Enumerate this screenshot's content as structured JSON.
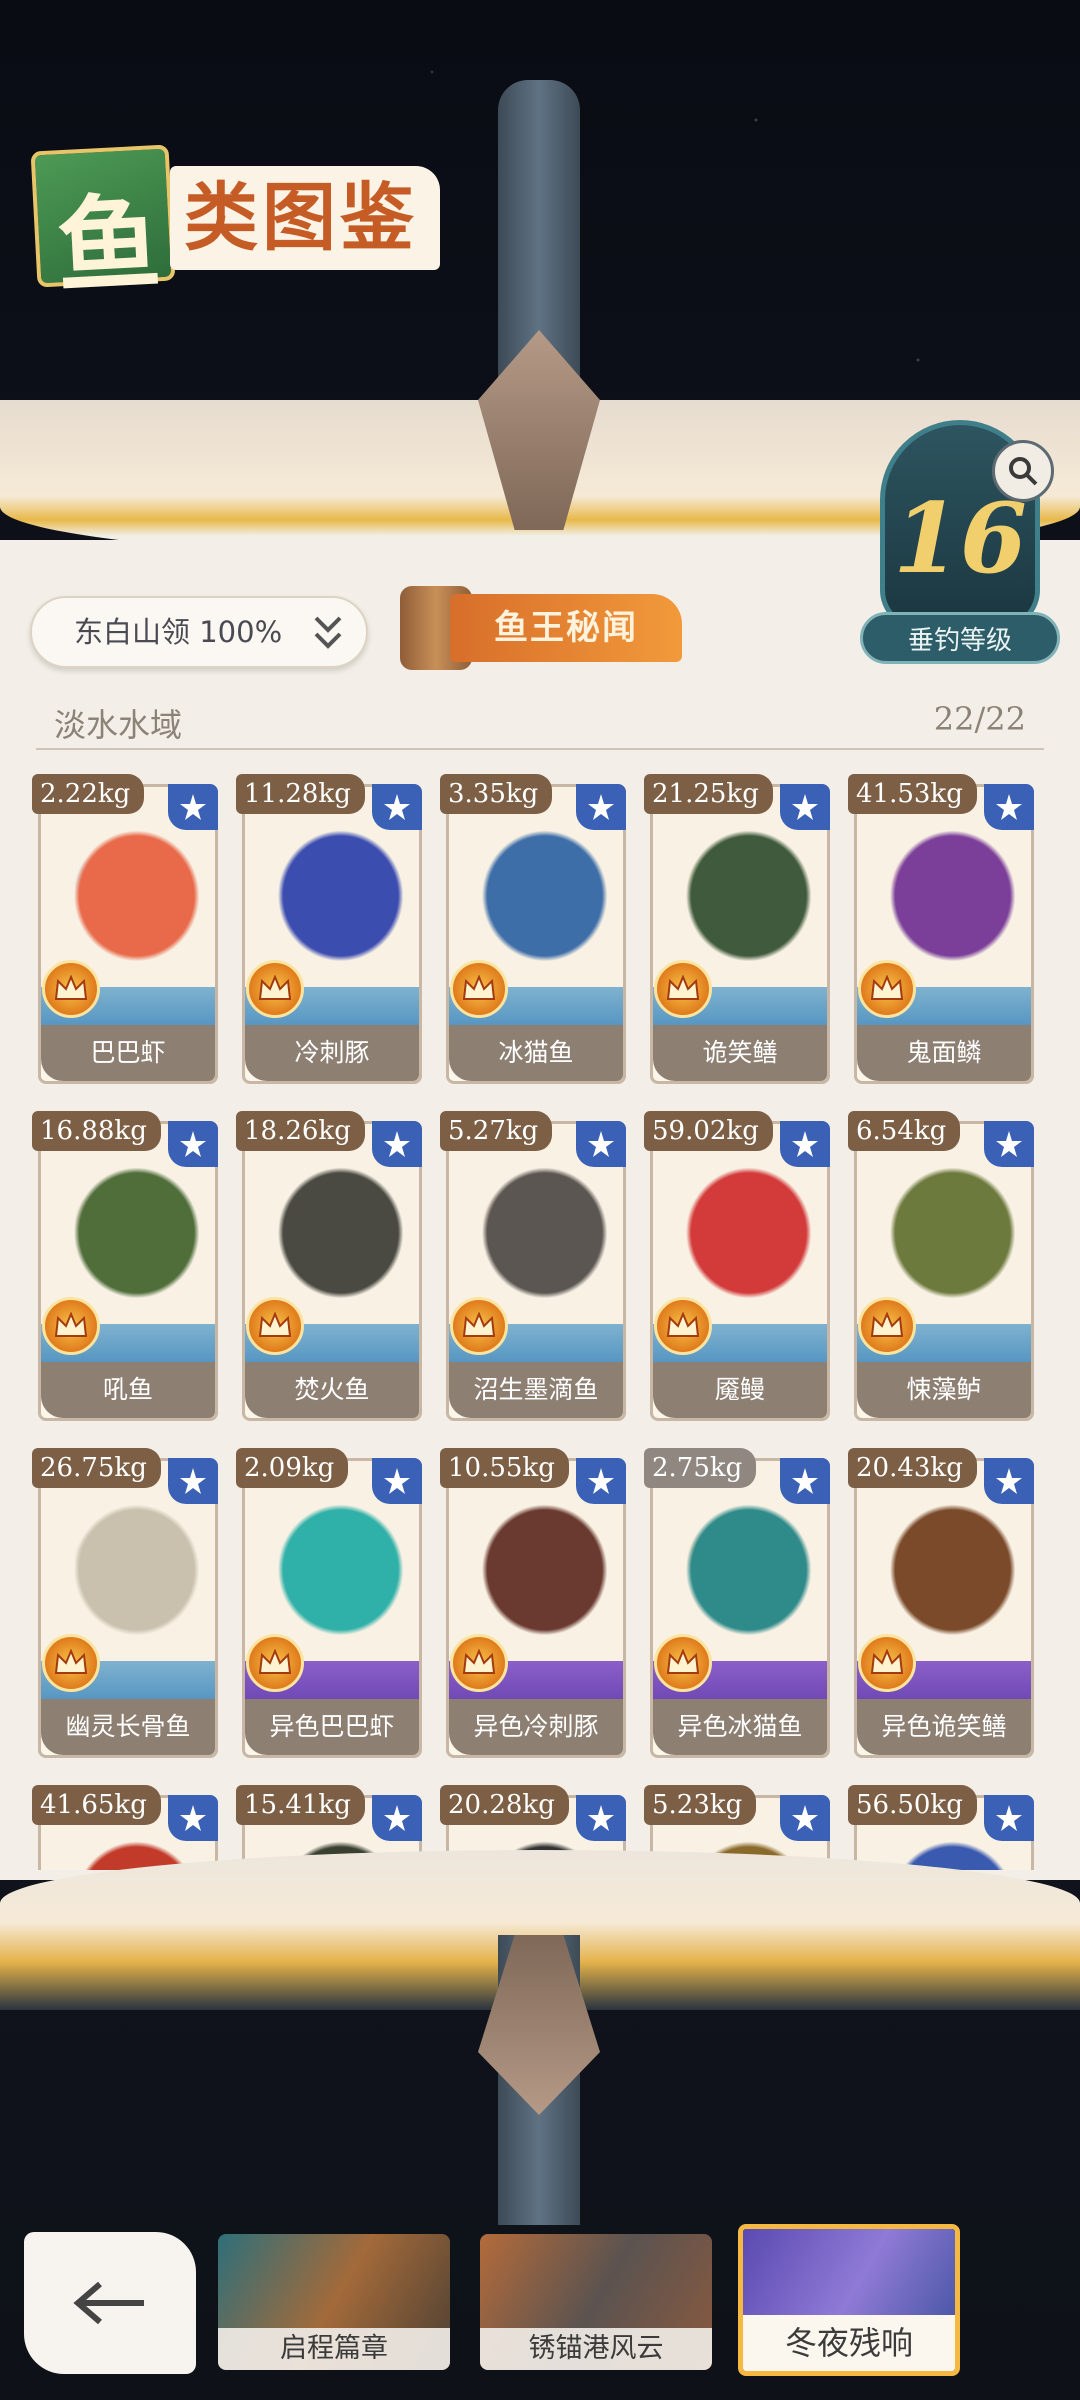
{
  "title": {
    "char_main": "鱼",
    "rest": "类图鉴"
  },
  "level": {
    "value": "16",
    "label": "垂钓等级"
  },
  "region": {
    "label": "东白山领 100%"
  },
  "fish_king_tab": {
    "label": "鱼王秘闻"
  },
  "section": {
    "name": "淡水水域",
    "count": "22/22"
  },
  "cards": [
    {
      "weight": "2.22kg",
      "name": "巴巴虾",
      "shiny": false
    },
    {
      "weight": "11.28kg",
      "name": "冷刺豚",
      "shiny": false
    },
    {
      "weight": "3.35kg",
      "name": "冰猫鱼",
      "shiny": false
    },
    {
      "weight": "21.25kg",
      "name": "诡笑鳝",
      "shiny": false
    },
    {
      "weight": "41.53kg",
      "name": "鬼面鳞",
      "shiny": false
    },
    {
      "weight": "16.88kg",
      "name": "吼鱼",
      "shiny": false
    },
    {
      "weight": "18.26kg",
      "name": "焚火鱼",
      "shiny": false
    },
    {
      "weight": "5.27kg",
      "name": "沼生墨滴鱼",
      "shiny": false
    },
    {
      "weight": "59.02kg",
      "name": "魇鳗",
      "shiny": false
    },
    {
      "weight": "6.54kg",
      "name": "悚藻鲈",
      "shiny": false
    },
    {
      "weight": "26.75kg",
      "name": "幽灵长骨鱼",
      "shiny": false
    },
    {
      "weight": "2.09kg",
      "name": "异色巴巴虾",
      "shiny": true
    },
    {
      "weight": "10.55kg",
      "name": "异色冷刺豚",
      "shiny": true
    },
    {
      "weight": "2.75kg",
      "name": "异色冰猫鱼",
      "shiny": true
    },
    {
      "weight": "20.43kg",
      "name": "异色诡笑鳝",
      "shiny": true
    },
    {
      "weight": "41.65kg",
      "name": "",
      "shiny": false
    },
    {
      "weight": "15.41kg",
      "name": "",
      "shiny": false
    },
    {
      "weight": "20.28kg",
      "name": "",
      "shiny": false
    },
    {
      "weight": "5.23kg",
      "name": "",
      "shiny": false
    },
    {
      "weight": "56.50kg",
      "name": "",
      "shiny": false
    }
  ],
  "tabs": [
    {
      "label": "启程篇章",
      "active": false
    },
    {
      "label": "锈锚港风云",
      "active": false
    },
    {
      "label": "冬夜残响",
      "active": true
    }
  ],
  "colors": {
    "accent_orange": "#e07b2a",
    "weight_tag": "#7d5f45",
    "star_badge": "#3a61b6",
    "shiny_wave": "#8b5fc9",
    "normal_wave": "#7fb2cf",
    "active_tab_border": "#f5b942"
  },
  "icons": {
    "back": "back-arrow-icon",
    "search": "search-icon",
    "chevron": "double-chevron-down-icon",
    "star": "star-icon",
    "crown": "crown-icon"
  }
}
